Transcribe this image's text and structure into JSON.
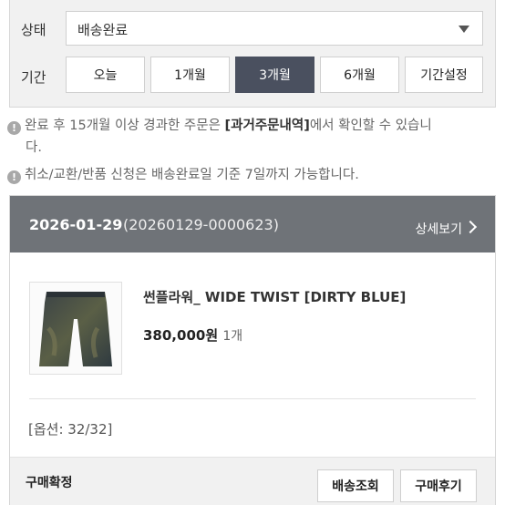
{
  "filter": {
    "status_label": "상태",
    "status_value": "배송완료",
    "period_label": "기간",
    "periods": [
      "오늘",
      "1개월",
      "3개월",
      "6개월",
      "기간설정"
    ],
    "active_period": "3개월"
  },
  "notices": {
    "line1_prefix": "완료 후 15개월 이상 경과한 주문은 ",
    "line1_link": "[과거주문내역]",
    "line1_suffix": "에서 확인할 수 있습니",
    "line1_cont": "다.",
    "line2": "취소/교환/반품 신청은 배송완료일 기준 7일까지 가능합니다."
  },
  "order": {
    "date": "2026-01-29",
    "order_no": "(20260129-0000623)",
    "detail_label": "상세보기",
    "product_name": "썬플라워_ WIDE TWIST [DIRTY BLUE]",
    "price": "380,000원",
    "quantity": "1개",
    "option": "[옵션: 32/32]",
    "status": "구매확정",
    "actions": [
      "배송조회",
      "구매후기"
    ]
  },
  "icons": {
    "info": "info-icon",
    "caret": "chevron-down-icon",
    "detail": "chevron-right-icon"
  },
  "colors": {
    "active_period_bg": "#4a505f",
    "order_header_bg": "#6f7378"
  }
}
